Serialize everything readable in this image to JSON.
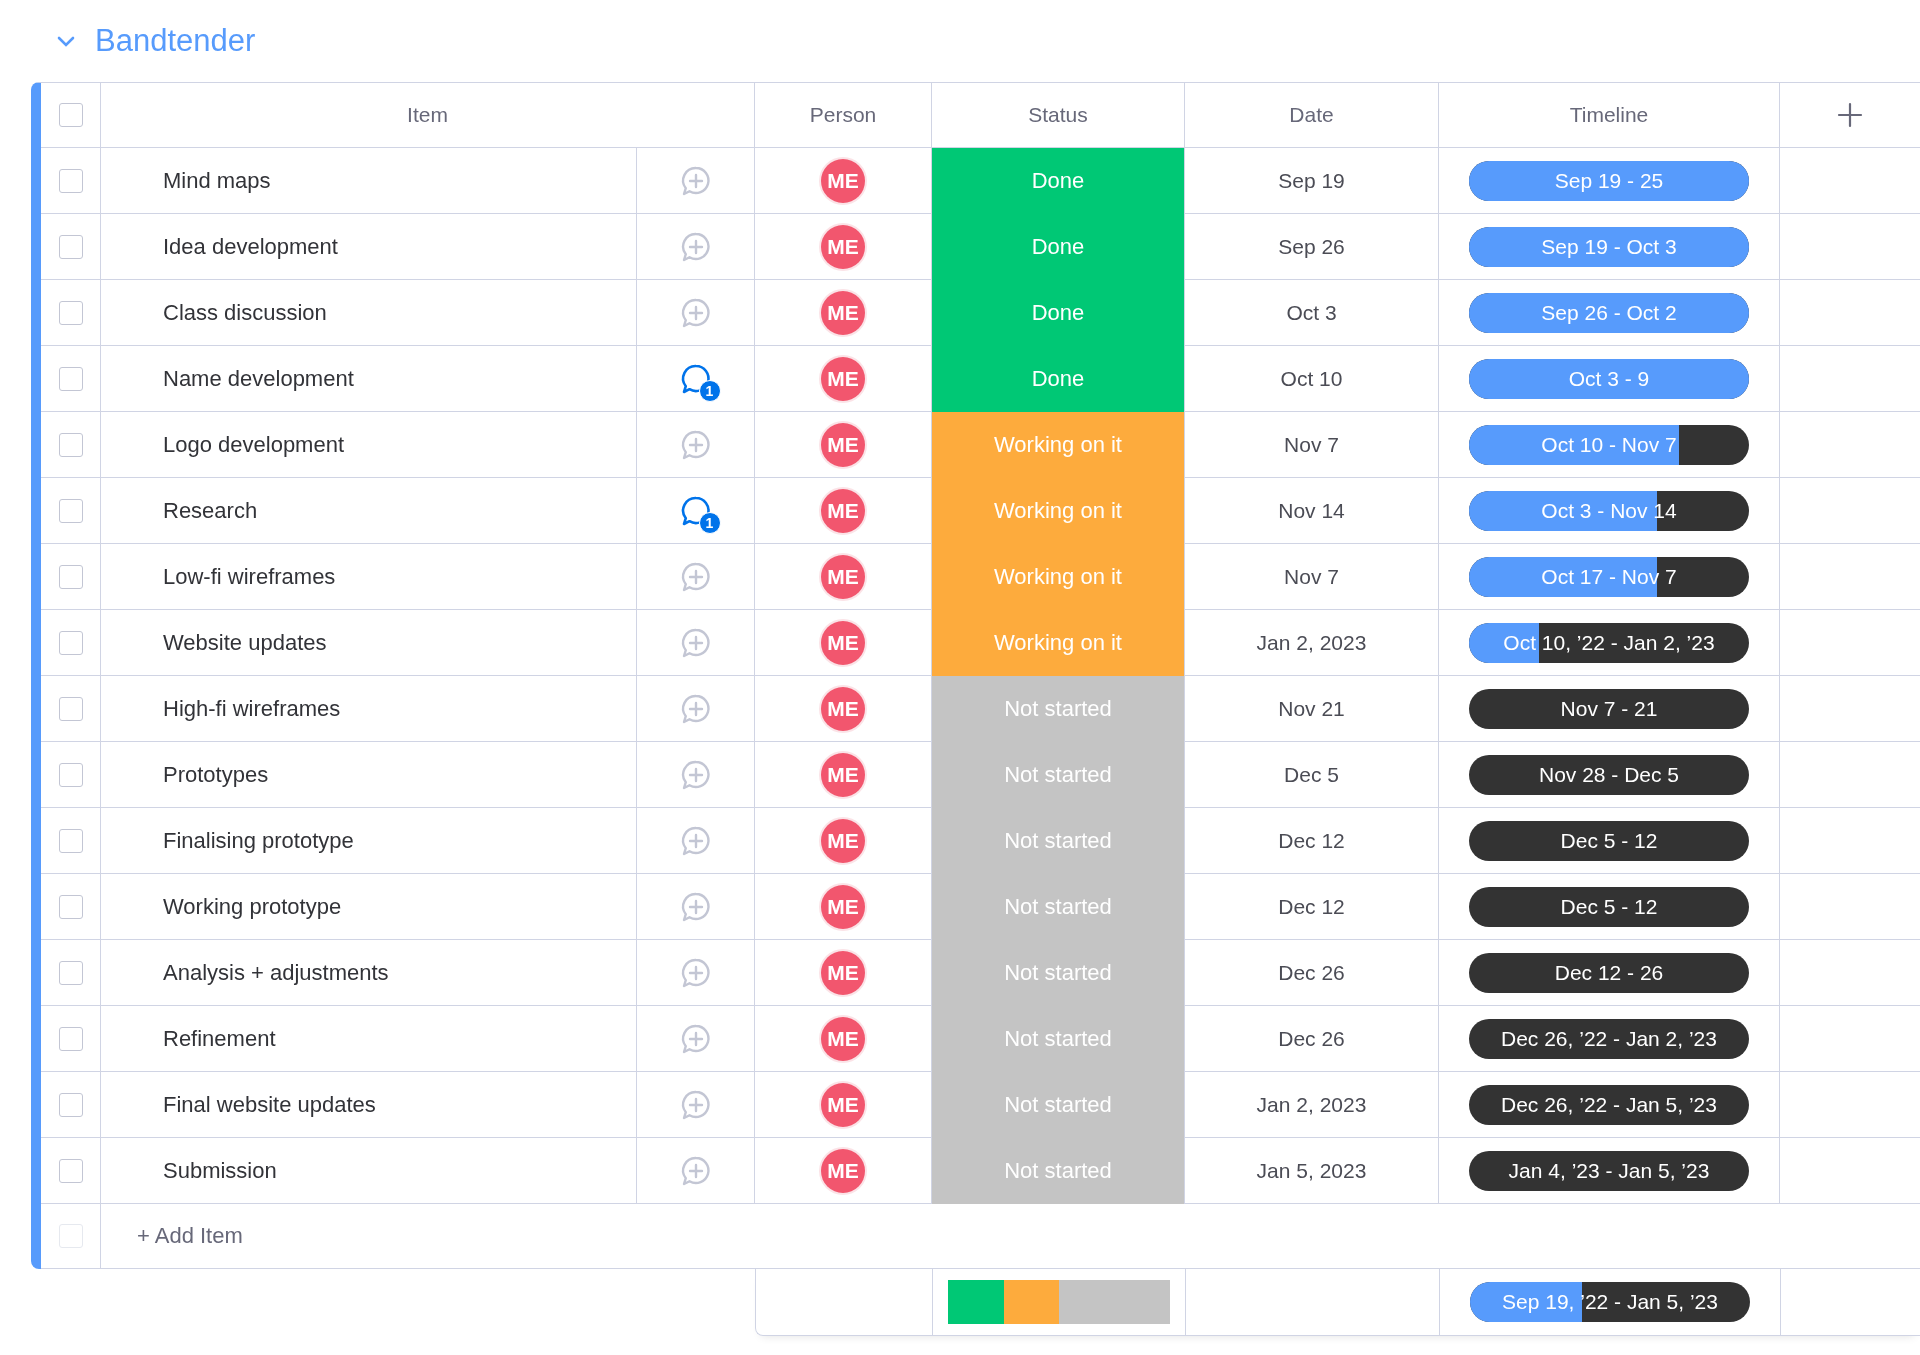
{
  "group": {
    "title": "Bandtender",
    "expanded": true
  },
  "columns": [
    "Item",
    "Person",
    "Status",
    "Date",
    "Timeline"
  ],
  "header_checkbox": {
    "checked": false
  },
  "rows": [
    {
      "item": "Mind maps",
      "checked": false,
      "comment": {
        "kind": "add"
      },
      "person": "ME",
      "status": {
        "label": "Done",
        "color": "#00c875"
      },
      "date": "Sep 19",
      "timeline": {
        "label": "Sep 19 - 25",
        "level": 1
      }
    },
    {
      "item": "Idea development",
      "checked": false,
      "comment": {
        "kind": "add"
      },
      "person": "ME",
      "status": {
        "label": "Done",
        "color": "#00c875"
      },
      "date": "Sep 26",
      "timeline": {
        "label": "Sep 19 - Oct 3",
        "level": 1
      }
    },
    {
      "item": "Class discussion",
      "checked": false,
      "comment": {
        "kind": "add"
      },
      "person": "ME",
      "status": {
        "label": "Done",
        "color": "#00c875"
      },
      "date": "Oct 3",
      "timeline": {
        "label": "Sep 26 - Oct 2",
        "level": 1
      }
    },
    {
      "item": "Name development",
      "checked": false,
      "comment": {
        "kind": "count",
        "count": "1"
      },
      "person": "ME",
      "status": {
        "label": "Done",
        "color": "#00c875"
      },
      "date": "Oct 10",
      "timeline": {
        "label": "Oct 3 - 9",
        "level": 1
      }
    },
    {
      "item": "Logo development",
      "checked": false,
      "comment": {
        "kind": "add"
      },
      "person": "ME",
      "status": {
        "label": "Working on it",
        "color": "#fdab3d"
      },
      "date": "Nov 7",
      "timeline": {
        "label": "Oct 10 - Nov 7",
        "level": 0.75
      }
    },
    {
      "item": "Research",
      "checked": false,
      "comment": {
        "kind": "count",
        "count": "1"
      },
      "person": "ME",
      "status": {
        "label": "Working on it",
        "color": "#fdab3d"
      },
      "date": "Nov 14",
      "timeline": {
        "label": "Oct 3 - Nov 14",
        "level": 0.67
      }
    },
    {
      "item": "Low-fi wireframes",
      "checked": false,
      "comment": {
        "kind": "add"
      },
      "person": "ME",
      "status": {
        "label": "Working on it",
        "color": "#fdab3d"
      },
      "date": "Nov 7",
      "timeline": {
        "label": "Oct 17 - Nov 7",
        "level": 0.67
      }
    },
    {
      "item": "Website updates",
      "checked": false,
      "comment": {
        "kind": "add"
      },
      "person": "ME",
      "status": {
        "label": "Working on it",
        "color": "#fdab3d"
      },
      "date": "Jan 2, 2023",
      "timeline": {
        "label": "Oct 10, ’22 - Jan 2, ’23",
        "level": 0.25
      }
    },
    {
      "item": "High-fi wireframes",
      "checked": false,
      "comment": {
        "kind": "add"
      },
      "person": "ME",
      "status": {
        "label": "Not started",
        "color": "#c4c4c4"
      },
      "date": "Nov 21",
      "timeline": {
        "label": "Nov 7 - 21"
      }
    },
    {
      "item": "Prototypes",
      "checked": false,
      "comment": {
        "kind": "add"
      },
      "person": "ME",
      "status": {
        "label": "Not started",
        "color": "#c4c4c4"
      },
      "date": "Dec 5",
      "timeline": {
        "label": "Nov 28 - Dec 5"
      }
    },
    {
      "item": "Finalising prototype",
      "checked": false,
      "comment": {
        "kind": "add"
      },
      "person": "ME",
      "status": {
        "label": "Not started",
        "color": "#c4c4c4"
      },
      "date": "Dec 12",
      "timeline": {
        "label": "Dec 5 - 12"
      }
    },
    {
      "item": "Working prototype",
      "checked": false,
      "comment": {
        "kind": "add"
      },
      "person": "ME",
      "status": {
        "label": "Not started",
        "color": "#c4c4c4"
      },
      "date": "Dec 12",
      "timeline": {
        "label": "Dec 5 - 12"
      }
    },
    {
      "item": "Analysis + adjustments",
      "checked": false,
      "comment": {
        "kind": "add"
      },
      "person": "ME",
      "status": {
        "label": "Not started",
        "color": "#c4c4c4"
      },
      "date": "Dec 26",
      "timeline": {
        "label": "Dec 12 - 26"
      }
    },
    {
      "item": "Refinement",
      "checked": false,
      "comment": {
        "kind": "add"
      },
      "person": "ME",
      "status": {
        "label": "Not started",
        "color": "#c4c4c4"
      },
      "date": "Dec 26",
      "timeline": {
        "label": "Dec 26, ’22 - Jan 2, ’23"
      }
    },
    {
      "item": "Final website updates",
      "checked": false,
      "comment": {
        "kind": "add"
      },
      "person": "ME",
      "status": {
        "label": "Not started",
        "color": "#c4c4c4"
      },
      "date": "Jan 2, 2023",
      "timeline": {
        "label": "Dec 26, ’22 - Jan 5, ’23"
      }
    },
    {
      "item": "Submission",
      "checked": false,
      "comment": {
        "kind": "add"
      },
      "person": "ME",
      "status": {
        "label": "Not started",
        "color": "#c4c4c4"
      },
      "date": "Jan 5, 2023",
      "timeline": {
        "label": "Jan 4, ’23 - Jan 5, ’23"
      }
    }
  ],
  "add_item": {
    "label": "+ Add Item",
    "checkbox_disabled": true
  },
  "summary": {
    "timeline": {
      "label": "Sep 19, ’22 - Jan 5, ’23",
      "level": 0.4
    }
  }
}
